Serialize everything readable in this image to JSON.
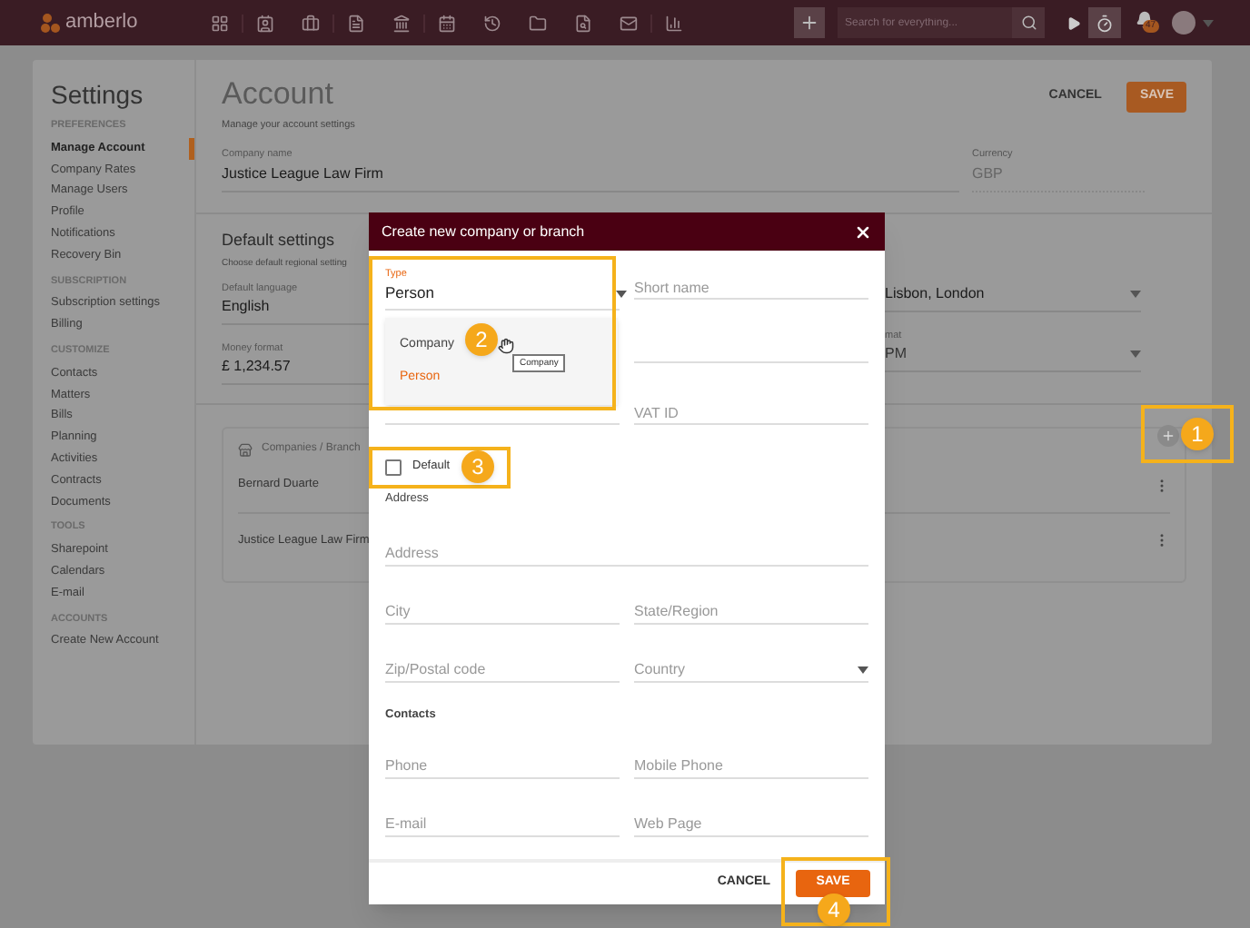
{
  "topbar": {
    "logo": "amberlo",
    "search": {
      "placeholder": "Search for everything..."
    },
    "notifications": "47"
  },
  "sidebar": {
    "title": "Settings",
    "sections": [
      {
        "heading": "PREFERENCES",
        "items": [
          {
            "label": "Manage Account",
            "selected": true
          },
          {
            "label": "Company Rates",
            "selected": false
          },
          {
            "label": "Manage Users",
            "selected": false
          },
          {
            "label": "Profile",
            "selected": false
          },
          {
            "label": "Notifications",
            "selected": false
          },
          {
            "label": "Recovery Bin",
            "selected": false
          }
        ]
      },
      {
        "heading": "SUBSCRIPTION",
        "items": [
          {
            "label": "Subscription settings",
            "selected": false
          },
          {
            "label": "Billing",
            "selected": false
          }
        ]
      },
      {
        "heading": "CUSTOMIZE",
        "items": [
          {
            "label": "Contacts",
            "selected": false
          },
          {
            "label": "Matters",
            "selected": false
          },
          {
            "label": "Bills",
            "selected": false
          },
          {
            "label": "Planning",
            "selected": false
          },
          {
            "label": "Activities",
            "selected": false
          },
          {
            "label": "Contracts",
            "selected": false
          },
          {
            "label": "Documents",
            "selected": false
          }
        ]
      },
      {
        "heading": "TOOLS",
        "items": [
          {
            "label": "Sharepoint",
            "selected": false
          },
          {
            "label": "Calendars",
            "selected": false
          },
          {
            "label": "E-mail",
            "selected": false
          }
        ]
      },
      {
        "heading": "ACCOUNTS",
        "items": [
          {
            "label": "Create New Account",
            "selected": false
          }
        ]
      }
    ]
  },
  "account": {
    "title": "Account",
    "subtitle": "Manage your account settings",
    "cancel": "CANCEL",
    "save": "SAVE",
    "company_name": {
      "label": "Company name",
      "value": "Justice League Law Firm"
    },
    "currency": {
      "label": "Currency",
      "value": "GBP"
    }
  },
  "default_settings": {
    "title": "Default settings",
    "subtitle": "Choose default regional setting",
    "language": {
      "label": "Default language",
      "value": "English"
    },
    "money_format": {
      "label": "Money format",
      "value": "£ 1,234.57"
    },
    "time_zone": {
      "value": "Lisbon, London"
    },
    "time_format": {
      "label": "mat",
      "value": "PM"
    }
  },
  "companies": {
    "title": "Companies / Branch",
    "rows": [
      "Bernard Duarte",
      "Justice League Law Firm"
    ]
  },
  "dialog": {
    "title": "Create new company or branch",
    "type_field": {
      "label": "Type",
      "value": "Person"
    },
    "short_name": {
      "placeholder": "Short name"
    },
    "type_menu": [
      {
        "label": "Company",
        "selected": false
      },
      {
        "label": "Person",
        "selected": true
      }
    ],
    "tooltip": "Company",
    "vat_id": {
      "placeholder": "VAT ID"
    },
    "default_checkbox": {
      "label": "Default",
      "checked": false
    },
    "address_heading": "Address",
    "address_rows": [
      [
        {
          "kind": "text",
          "placeholder": "Address"
        }
      ],
      [
        {
          "kind": "text",
          "placeholder": "City"
        },
        {
          "kind": "text",
          "placeholder": "State/Region"
        }
      ],
      [
        {
          "kind": "text",
          "placeholder": "Zip/Postal code"
        },
        {
          "kind": "select",
          "placeholder": "Country"
        }
      ]
    ],
    "contacts_heading": "Contacts",
    "contact_rows": [
      [
        {
          "kind": "text",
          "placeholder": "Phone"
        },
        {
          "kind": "text",
          "placeholder": "Mobile Phone"
        }
      ],
      [
        {
          "kind": "text",
          "placeholder": "E-mail"
        },
        {
          "kind": "text",
          "placeholder": "Web Page"
        }
      ]
    ],
    "cancel": "CANCEL",
    "save": "SAVE"
  },
  "callouts": [
    {
      "number": "1"
    },
    {
      "number": "2"
    },
    {
      "number": "3"
    },
    {
      "number": "4"
    }
  ]
}
